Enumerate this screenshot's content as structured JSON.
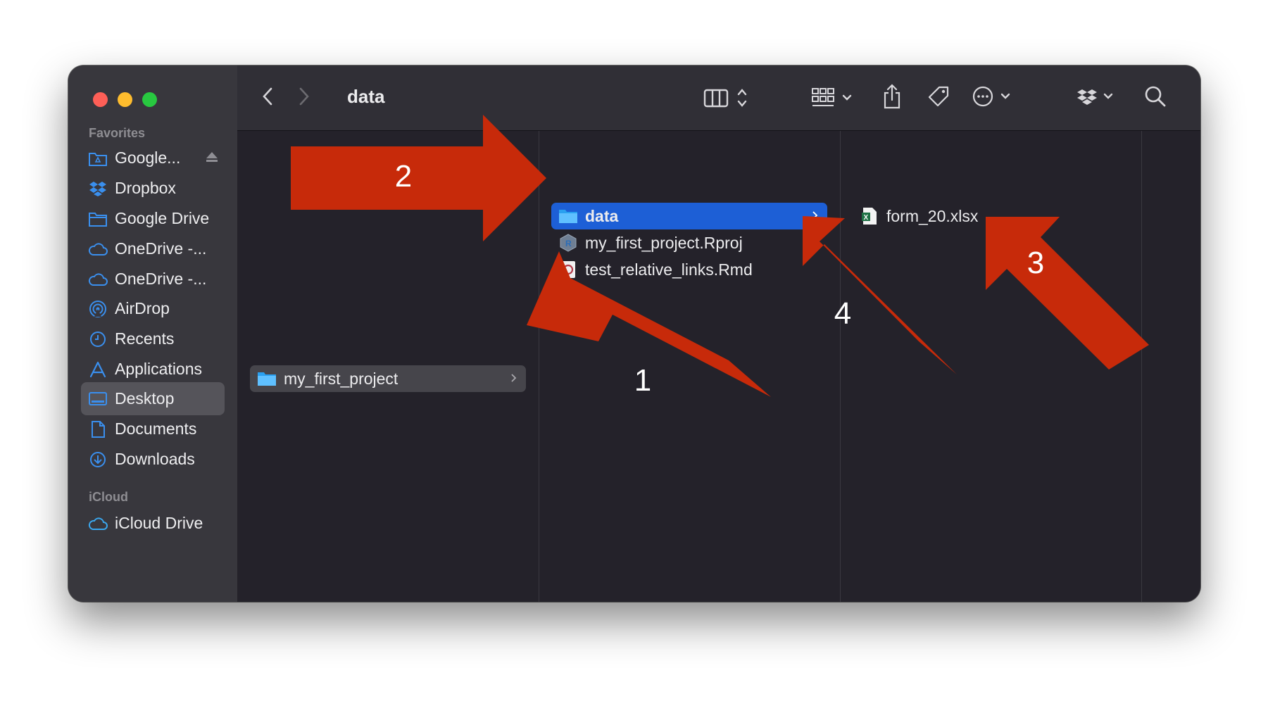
{
  "window": {
    "title": "data"
  },
  "sidebar": {
    "favorites_title": "Favorites",
    "items": [
      {
        "label": "Google...",
        "icon": "google-drive-folder-icon"
      },
      {
        "label": "Dropbox",
        "icon": "dropbox-icon"
      },
      {
        "label": "Google Drive",
        "icon": "folder-icon"
      },
      {
        "label": "OneDrive -...",
        "icon": "cloud-icon"
      },
      {
        "label": "OneDrive -...",
        "icon": "cloud-icon"
      },
      {
        "label": "AirDrop",
        "icon": "airdrop-icon"
      },
      {
        "label": "Recents",
        "icon": "clock-icon"
      },
      {
        "label": "Applications",
        "icon": "applications-icon"
      },
      {
        "label": "Desktop",
        "icon": "desktop-icon",
        "selected": true
      },
      {
        "label": "Documents",
        "icon": "document-icon"
      },
      {
        "label": "Downloads",
        "icon": "download-icon"
      }
    ],
    "icloud_title": "iCloud",
    "icloud_items": [
      {
        "label": "iCloud Drive",
        "icon": "icloud-icon"
      }
    ]
  },
  "columns": [
    {
      "items": [
        {
          "label": "my_first_project",
          "type": "folder",
          "selected": "gray"
        }
      ]
    },
    {
      "items": [
        {
          "label": "data",
          "type": "folder",
          "selected": "blue"
        },
        {
          "label": "my_first_project.Rproj",
          "type": "rproj"
        },
        {
          "label": "test_relative_links.Rmd",
          "type": "rmd"
        }
      ]
    },
    {
      "items": [
        {
          "label": "form_20.xlsx",
          "type": "xlsx"
        }
      ]
    }
  ],
  "annotations": {
    "color": "#c72a0a",
    "arrows": [
      "1",
      "2",
      "3",
      "4"
    ]
  }
}
